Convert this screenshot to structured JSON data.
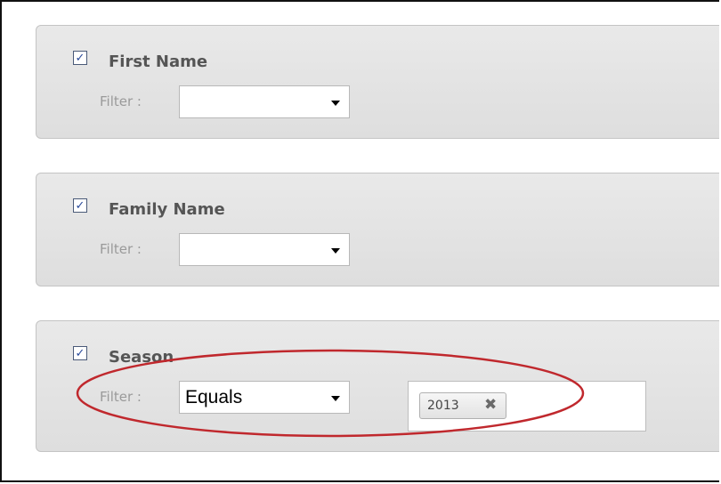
{
  "fields": [
    {
      "title": "First Name",
      "checked": true,
      "filter_label": "Filter :",
      "operator": ""
    },
    {
      "title": "Family Name",
      "checked": true,
      "filter_label": "Filter :",
      "operator": ""
    },
    {
      "title": "Season",
      "checked": true,
      "filter_label": "Filter :",
      "operator": "Equals",
      "tags": [
        {
          "text": "2013",
          "remove_glyph": "✖"
        }
      ]
    }
  ],
  "checkbox_glyph": "✓",
  "annotation": {
    "color": "#c0282d"
  }
}
